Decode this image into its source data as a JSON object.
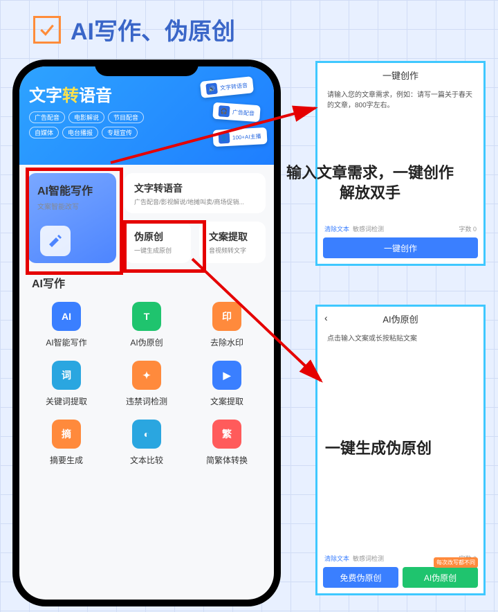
{
  "heading": "AI写作、伪原创",
  "banner": {
    "title_before": "文字",
    "title_mid": "转",
    "title_after": "语音",
    "chips": [
      "广告配音",
      "电影解说",
      "节目配音",
      "自媒体",
      "电台播报",
      "专题宣传"
    ],
    "mini_cards": [
      "文字转语音",
      "广告配音",
      "100+AI主播"
    ]
  },
  "tiles": {
    "ai_write": {
      "title": "AI智能写作",
      "sub": "文案智能改写"
    },
    "tts": {
      "title": "文字转语音",
      "sub": "广告配音/影视解说/地摊叫卖/商场促销..."
    },
    "pseudo": {
      "title": "伪原创",
      "sub": "一键生成原创"
    },
    "extract": {
      "title": "文案提取",
      "sub": "音视频转文字"
    }
  },
  "section_title": "AI写作",
  "apps": [
    {
      "label": "AI智能写作",
      "icon": "AI",
      "cls": "ic-blue"
    },
    {
      "label": "AI伪原创",
      "icon": "T",
      "cls": "ic-green"
    },
    {
      "label": "去除水印",
      "icon": "印",
      "cls": "ic-orange"
    },
    {
      "label": "关键词提取",
      "icon": "词",
      "cls": "ic-teal"
    },
    {
      "label": "违禁词检测",
      "icon": "✦",
      "cls": "ic-org2"
    },
    {
      "label": "文案提取",
      "icon": "▶",
      "cls": "ic-blue"
    },
    {
      "label": "摘要生成",
      "icon": "摘",
      "cls": "ic-orange"
    },
    {
      "label": "文本比较",
      "icon": "◐",
      "cls": "ic-teal"
    },
    {
      "label": "简繁体转换",
      "icon": "繁",
      "cls": "ic-red"
    }
  ],
  "panel_top": {
    "title": "一键创作",
    "body": "请输入您的文章需求，例如：请写一篇关于春天的文章，800字左右。",
    "clear": "清除文本",
    "sens": "敏感词检测",
    "count": "字数 0",
    "btn": "一键创作"
  },
  "panel_bot": {
    "title": "AI伪原创",
    "body": "点击输入文案或长按粘贴文案",
    "clear": "清除文本",
    "sens": "敏感词检测",
    "count": "字数 0",
    "btn_left": "免费伪原创",
    "btn_right": "AI伪原创",
    "badge": "每次改写都不同"
  },
  "caption1_line1": "输入文章需求，一键创作",
  "caption1_line2": "解放双手",
  "caption2": "一键生成伪原创"
}
